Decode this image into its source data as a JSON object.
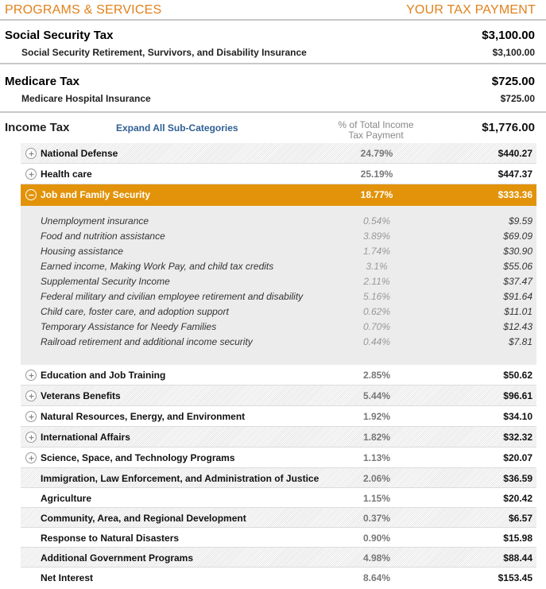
{
  "header": {
    "left": "PROGRAMS & SERVICES",
    "right": "YOUR TAX PAYMENT"
  },
  "social_security": {
    "title": "Social Security Tax",
    "total": "$3,100.00",
    "sub_label": "Social Security Retirement, Survivors, and Disability Insurance",
    "sub_amount": "$3,100.00"
  },
  "medicare": {
    "title": "Medicare Tax",
    "total": "$725.00",
    "sub_label": "Medicare Hospital Insurance",
    "sub_amount": "$725.00"
  },
  "income_tax": {
    "title": "Income Tax",
    "expand_label": "Expand All Sub-Categories",
    "pct_header_line1": "% of Total Income",
    "pct_header_line2": "Tax Payment",
    "total": "$1,776.00"
  },
  "categories_top": [
    {
      "label": "National Defense",
      "pct": "24.79%",
      "amount": "$440.27",
      "icon": "plus-circle-icon"
    },
    {
      "label": "Health care",
      "pct": "25.19%",
      "amount": "$447.37",
      "icon": "plus-circle-icon"
    }
  ],
  "active_category": {
    "label": "Job and Family Security",
    "pct": "18.77%",
    "amount": "$333.36",
    "icon": "minus-circle-icon"
  },
  "subcategories": [
    {
      "label": "Unemployment insurance",
      "pct": "0.54%",
      "amount": "$9.59"
    },
    {
      "label": "Food and nutrition assistance",
      "pct": "3.89%",
      "amount": "$69.09"
    },
    {
      "label": "Housing assistance",
      "pct": "1.74%",
      "amount": "$30.90"
    },
    {
      "label": "Earned income, Making Work Pay, and child tax credits",
      "pct": "3.1%",
      "amount": "$55.06"
    },
    {
      "label": "Supplemental Security Income",
      "pct": "2.11%",
      "amount": "$37.47"
    },
    {
      "label": "Federal military and civilian employee retirement and disability",
      "pct": "5.16%",
      "amount": "$91.64"
    },
    {
      "label": "Child care, foster care, and adoption support",
      "pct": "0.62%",
      "amount": "$11.01"
    },
    {
      "label": "Temporary Assistance for Needy Families",
      "pct": "0.70%",
      "amount": "$12.43"
    },
    {
      "label": "Railroad retirement and additional income security",
      "pct": "0.44%",
      "amount": "$7.81"
    }
  ],
  "categories_bottom": [
    {
      "label": "Education and Job Training",
      "pct": "2.85%",
      "amount": "$50.62",
      "icon": "plus-circle-icon"
    },
    {
      "label": "Veterans Benefits",
      "pct": "5.44%",
      "amount": "$96.61",
      "icon": "plus-circle-icon"
    },
    {
      "label": "Natural Resources, Energy, and Environment",
      "pct": "1.92%",
      "amount": "$34.10",
      "icon": "plus-circle-icon"
    },
    {
      "label": "International Affairs",
      "pct": "1.82%",
      "amount": "$32.32",
      "icon": "plus-circle-icon"
    },
    {
      "label": "Science, Space, and Technology Programs",
      "pct": "1.13%",
      "amount": "$20.07",
      "icon": "plus-circle-icon"
    },
    {
      "label": "Immigration, Law Enforcement, and Administration of Justice",
      "pct": "2.06%",
      "amount": "$36.59"
    },
    {
      "label": "Agriculture",
      "pct": "1.15%",
      "amount": "$20.42"
    },
    {
      "label": "Community, Area, and Regional Development",
      "pct": "0.37%",
      "amount": "$6.57"
    },
    {
      "label": "Response to Natural Disasters",
      "pct": "0.90%",
      "amount": "$15.98"
    },
    {
      "label": "Additional Government Programs",
      "pct": "4.98%",
      "amount": "$88.44"
    },
    {
      "label": "Net Interest",
      "pct": "8.64%",
      "amount": "$153.45"
    }
  ],
  "colors": {
    "accent": "#e2801a",
    "active_row": "#e2930a",
    "link": "#2f5f93"
  }
}
